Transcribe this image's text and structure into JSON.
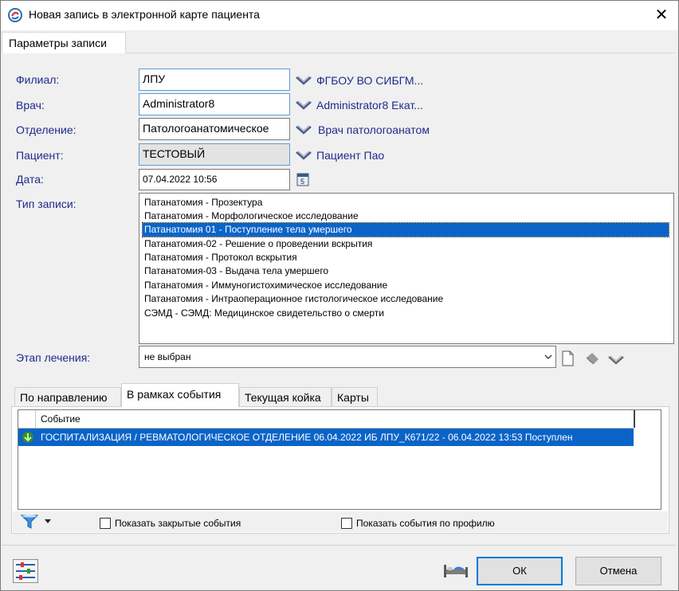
{
  "window": {
    "title": "Новая запись в электронной карте пациента",
    "close": "✕"
  },
  "outer_tab": "Параметры записи",
  "form": {
    "branch": {
      "label": "Филиал:",
      "value": "ЛПУ",
      "link": "ФГБОУ ВО СИБГМ..."
    },
    "doctor": {
      "label": "Врач:",
      "value": "Administrator8",
      "link": "Administrator8 Екат..."
    },
    "department": {
      "label": "Отделение:",
      "value": "Патологоанатомическое",
      "link": "Врач патологоанатом"
    },
    "patient": {
      "label": "Пациент:",
      "value": "ТЕСТОВЫЙ",
      "link": "Пациент Пао"
    },
    "date": {
      "label": "Дата:",
      "value": "07.04.2022 10:56"
    },
    "record_type": {
      "label": "Тип записи:",
      "items": [
        "Патанатомия - Прозектура",
        "Патанатомия - Морфологическое исследование",
        "Патанатомия 01 - Поступление тела умершего",
        "Патанатомия-02 - Решение о проведении вскрытия",
        "Патанатомия - Протокол вскрытия",
        "Патанатомия-03 - Выдача тела умершего",
        "Патанатомия - Иммуногистохимическое исследование",
        "Патанатомия - Интраоперационное гистологическое исследование",
        "СЭМД - СЭМД: Медицинское свидетельство о смерти"
      ],
      "selected_index": 2
    },
    "stage": {
      "label": "Этап лечения:",
      "value": "не выбран"
    }
  },
  "inner_tabs": [
    "По направлению",
    "В рамках события",
    "Текущая койка",
    "Карты"
  ],
  "active_inner_tab": 1,
  "events_grid": {
    "column": "Событие",
    "rows": [
      "ГОСПИТАЛИЗАЦИЯ / РЕВМАТОЛОГИЧЕСКОЕ ОТДЕЛЕНИЕ 06.04.2022 ИБ ЛПУ_К671/22 - 06.04.2022 13:53 Поступлен"
    ]
  },
  "filters": {
    "show_closed": "Показать закрытые события",
    "show_by_profile": "Показать события по профилю"
  },
  "buttons": {
    "ok": "ОК",
    "cancel": "Отмена"
  },
  "colors": {
    "selection": "#0a64c8",
    "label": "#1f2a8c",
    "focus": "#0078d7"
  }
}
